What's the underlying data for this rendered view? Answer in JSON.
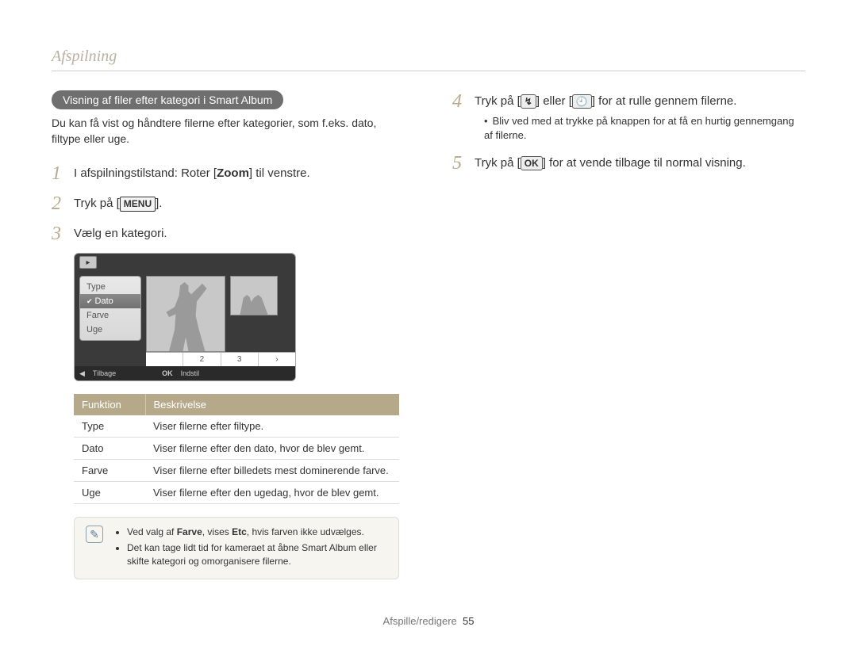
{
  "section": "Afspilning",
  "left": {
    "pill": "Visning af filer efter kategori i Smart Album",
    "intro": "Du kan få vist og håndtere filerne efter kategorier, som f.eks. dato, filtype eller uge.",
    "step1_num": "1",
    "step1_pre": "I afspilningstilstand: Roter [",
    "step1_zoom": "Zoom",
    "step1_post": "] til venstre.",
    "step2_num": "2",
    "step2_pre": "Tryk på [",
    "step2_menu": "MENU",
    "step2_post": "].",
    "step3_num": "3",
    "step3_text": "Vælg en kategori.",
    "screenshot": {
      "menu_type": "Type",
      "menu_dato": "Dato",
      "menu_farve": "Farve",
      "menu_uge": "Uge",
      "strip1": "",
      "strip2": "2",
      "strip3": "3",
      "strip4": "›",
      "back_arrow": "◀",
      "back_text": "Tilbage",
      "ok": "OK",
      "set": "Indstil"
    },
    "table": {
      "h1": "Funktion",
      "h2": "Beskrivelse",
      "r1c1": "Type",
      "r1c2": "Viser filerne efter filtype.",
      "r2c1": "Dato",
      "r2c2": "Viser filerne efter den dato, hvor de blev gemt.",
      "r3c1": "Farve",
      "r3c2": "Viser filerne efter billedets mest dominerende farve.",
      "r4c1": "Uge",
      "r4c2": "Viser filerne efter den ugedag, hvor de blev gemt."
    },
    "note": {
      "b1_pre": "Ved valg af ",
      "b1_farve": "Farve",
      "b1_mid": ", vises ",
      "b1_etc": "Etc",
      "b1_post": ", hvis farven ikke udvælges.",
      "b2": "Det kan tage lidt tid for kameraet at åbne Smart Album eller skifte kategori og omorganisere filerne."
    }
  },
  "right": {
    "step4_num": "4",
    "step4_pre": "Tryk på [",
    "step4_icon1": "↯",
    "step4_mid": "] eller [",
    "step4_icon2": "🕘",
    "step4_post": "] for at rulle gennem filerne.",
    "step4_sub": "Bliv ved med at trykke på knappen for at få en hurtig gennemgang af filerne.",
    "step5_num": "5",
    "step5_pre": "Tryk på [",
    "step5_ok": "OK",
    "step5_post": "] for at vende tilbage til normal visning."
  },
  "footer": {
    "label": "Afspille/redigere",
    "page": "55"
  }
}
